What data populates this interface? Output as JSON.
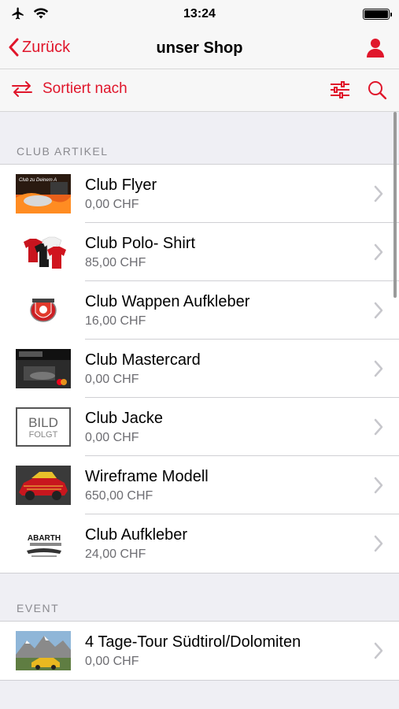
{
  "status_bar": {
    "time": "13:24"
  },
  "nav": {
    "back_label": "Zurück",
    "title": "unser Shop"
  },
  "toolbar": {
    "sort_label": "Sortiert nach"
  },
  "sections": [
    {
      "header": "CLUB ARTIKEL",
      "items": [
        {
          "title": "Club Flyer",
          "price": "0,00 CHF"
        },
        {
          "title": "Club Polo- Shirt",
          "price": "85,00 CHF"
        },
        {
          "title": "Club Wappen Aufkleber",
          "price": "16,00 CHF"
        },
        {
          "title": "Club Mastercard",
          "price": "0,00 CHF"
        },
        {
          "title": "Club Jacke",
          "price": "0,00 CHF"
        },
        {
          "title": "Wireframe Modell",
          "price": "650,00 CHF"
        },
        {
          "title": "Club Aufkleber",
          "price": "24,00 CHF"
        }
      ]
    },
    {
      "header": "EVENT",
      "items": [
        {
          "title": "4 Tage-Tour Südtirol/Dolomiten",
          "price": "0,00 CHF"
        }
      ]
    }
  ],
  "thumbs": {
    "flyer_text": "Club zu Deinem A",
    "jacke_line1": "BILD",
    "jacke_line2": "FOLGT",
    "aufkleber_text": "ABARTH"
  },
  "colors": {
    "accent": "#e0162b"
  }
}
